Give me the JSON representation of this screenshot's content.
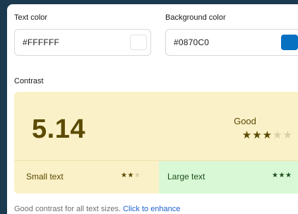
{
  "text_color": {
    "label": "Text color",
    "value": "#FFFFFF",
    "swatch": "#FFFFFF"
  },
  "background_color": {
    "label": "Background color",
    "value": "#0870C0",
    "swatch": "#0870C0"
  },
  "contrast": {
    "label": "Contrast",
    "ratio": "5.14",
    "rating": "Good",
    "stars": {
      "filled": 3,
      "total": 5
    },
    "small_text": {
      "label": "Small text",
      "stars_filled": 2,
      "stars_total": 3
    },
    "large_text": {
      "label": "Large text",
      "stars_filled": 3,
      "stars_total": 3
    }
  },
  "footer": {
    "message": "Good contrast for all text sizes.",
    "link_label": "Click to enhance"
  },
  "colors": {
    "page_bg": "#1C3A4F",
    "good_bg": "#FBF1C9",
    "good_fg": "#5B4A00",
    "large_bg": "#D9F9D6",
    "large_fg": "#1D4D1D",
    "link": "#1F62D0"
  }
}
